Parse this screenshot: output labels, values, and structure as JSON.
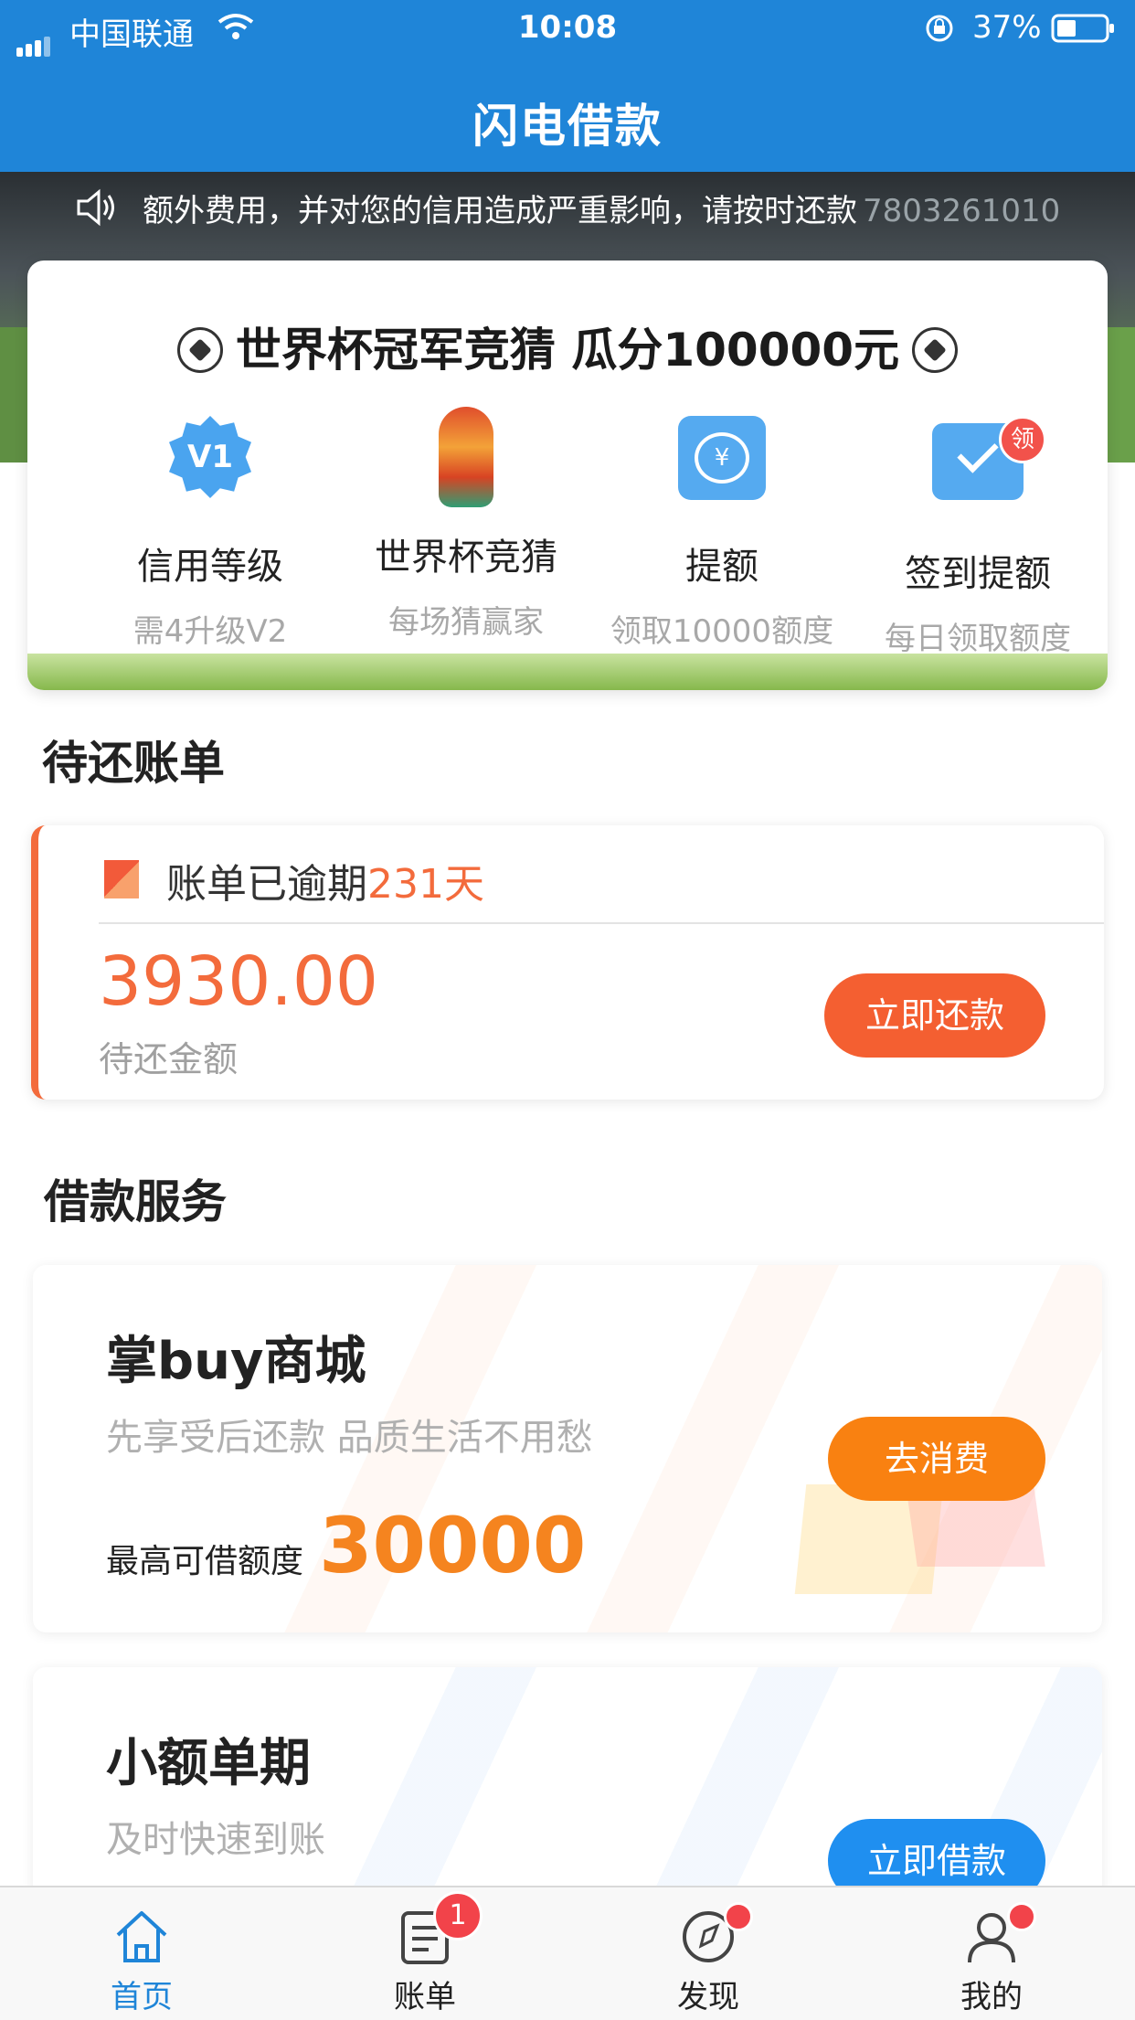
{
  "status_bar": {
    "carrier": "中国联通",
    "time": "10:08",
    "battery": "37%"
  },
  "nav": {
    "title": "闪电借款"
  },
  "notice": {
    "text": "额外费用，并对您的信用造成严重影响，请按时还款",
    "number": "7803261010"
  },
  "promo": {
    "title": "世界杯冠军竞猜 瓜分100000元",
    "features": [
      {
        "label": "信用等级",
        "sub": "需4升级V2",
        "icon": "v1-badge-icon",
        "badge_text": "V1"
      },
      {
        "label": "世界杯竞猜",
        "sub": "每场猜赢家",
        "icon": "trophy-icon"
      },
      {
        "label": "提额",
        "sub": "领取10000额度",
        "icon": "yuan-refresh-icon",
        "symbol": "¥"
      },
      {
        "label": "签到提额",
        "sub": "每日领取额度",
        "icon": "calendar-check-icon",
        "badge_text": "领"
      }
    ]
  },
  "bills": {
    "section_title": "待还账单",
    "status_prefix": "账单已逾期",
    "overdue_days": "231天",
    "amount": "3930.00",
    "amount_label": "待还金额",
    "repay_button": "立即还款"
  },
  "services": {
    "section_title": "借款服务",
    "cards": [
      {
        "title": "掌buy商城",
        "subtitle": "先享受后还款 品质生活不用愁",
        "limit_label": "最高可借额度",
        "limit_value": "30000",
        "button": "去消费"
      },
      {
        "title": "小额单期",
        "subtitle": "及时快速到账",
        "button": "立即借款"
      }
    ]
  },
  "tabbar": {
    "tabs": [
      {
        "label": "首页",
        "active": true
      },
      {
        "label": "账单",
        "badge": "1"
      },
      {
        "label": "发现",
        "dot": true
      },
      {
        "label": "我的",
        "dot": true
      }
    ]
  },
  "colors": {
    "primary_blue": "#1f85d8",
    "accent_orange": "#f36b3c",
    "shop_orange": "#f98111",
    "badge_red": "#f2434a"
  }
}
